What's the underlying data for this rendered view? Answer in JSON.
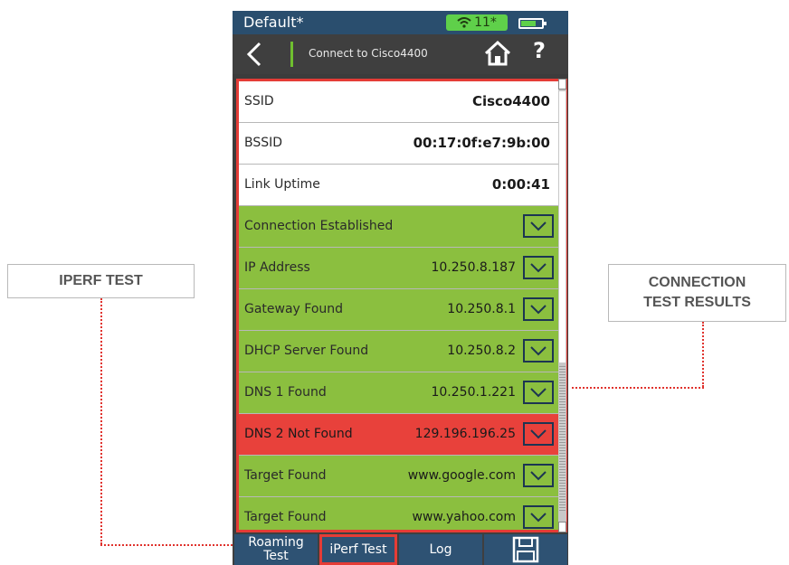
{
  "callouts": {
    "iperf": "IPERF TEST",
    "connection_line1": "CONNECTION",
    "connection_line2": "TEST RESULTS"
  },
  "status_bar": {
    "profile": "Default*",
    "wifi_count": "11*",
    "icons": [
      "wifi-icon",
      "battery-icon"
    ]
  },
  "nav_bar": {
    "title": "Connect to Cisco4400",
    "icons": [
      "back-chevron-icon",
      "home-icon",
      "help-icon"
    ],
    "help": "?"
  },
  "info_rows": [
    {
      "label": "SSID",
      "value": "Cisco4400"
    },
    {
      "label": "BSSID",
      "value": "00:17:0f:e7:9b:00"
    },
    {
      "label": "Link Uptime",
      "value": "0:00:41"
    }
  ],
  "test_rows": [
    {
      "label": "Connection Established",
      "value": "",
      "status": "pass"
    },
    {
      "label": "IP Address",
      "value": "10.250.8.187",
      "status": "pass"
    },
    {
      "label": "Gateway Found",
      "value": "10.250.8.1",
      "status": "pass"
    },
    {
      "label": "DHCP Server Found",
      "value": "10.250.8.2",
      "status": "pass"
    },
    {
      "label": "DNS 1 Found",
      "value": "10.250.1.221",
      "status": "pass"
    },
    {
      "label": "DNS 2 Not Found",
      "value": "129.196.196.25",
      "status": "fail"
    },
    {
      "label": "Target Found",
      "value": "www.google.com",
      "status": "pass"
    },
    {
      "label": "Target Found",
      "value": "www.yahoo.com",
      "status": "pass"
    }
  ],
  "toolbar": {
    "roaming_line1": "Roaming",
    "roaming_line2": "Test",
    "iperf": "iPerf Test",
    "log": "Log",
    "save_icon": "save-icon"
  },
  "colors": {
    "pass": "#8bbf3f",
    "fail": "#e8413b",
    "highlight": "#e53c36",
    "header": "#2a4e6e",
    "button": "#2e5273"
  }
}
